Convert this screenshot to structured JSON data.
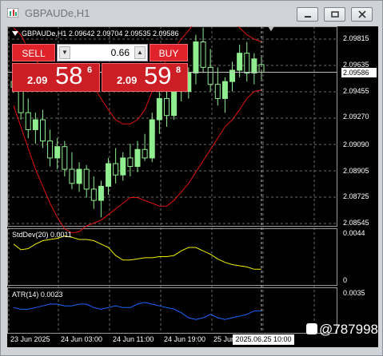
{
  "window": {
    "title": "GBPAUDe,H1",
    "minimize_icon": "minimize-icon",
    "restore_icon": "restore-icon",
    "close_icon": "close-icon"
  },
  "chart_header": {
    "symbol_line": "GBPAUDe,H1  2.09642 2.09704 2.09535 2.09586"
  },
  "trade_panel": {
    "sell_label": "SELL",
    "buy_label": "BUY",
    "lot_value": "0.66",
    "sell_quote": {
      "prefix": "2.09",
      "big": "58",
      "sup": "6"
    },
    "buy_quote": {
      "prefix": "2.09",
      "big": "59",
      "sup": "8"
    }
  },
  "price_axis": {
    "labels": [
      "2.09815",
      "2.09635",
      "2.09455",
      "2.09270",
      "2.09090",
      "2.08905",
      "2.08725",
      "2.08545"
    ],
    "current_price": "2.09586"
  },
  "stddev_panel": {
    "label": "StdDev(20) 0.0011",
    "axis_labels": [
      "0.0044",
      "0"
    ]
  },
  "atr_panel": {
    "label": "ATR(14) 0.0023",
    "axis_labels": [
      "0.0035"
    ]
  },
  "time_axis": {
    "labels": [
      "23 Jun 2025",
      "24 Jun 03:00",
      "24 Jun 11:00",
      "24 Jun 19:00",
      "25 Jun"
    ],
    "crosshair_time": "2025.06.25 10:00"
  },
  "colors": {
    "bull_candle": "#90ee90",
    "bear_candle": "#000000",
    "bollinger": "#e01010",
    "stddev_line": "#f0f000",
    "atr_line": "#1e64ff",
    "sell_buy_red": "#e0232b"
  },
  "watermark": {
    "text": "@787998"
  },
  "chart_data": {
    "type": "candlestick",
    "title": "GBPAUDe,H1",
    "ohlc_last": {
      "open": 2.09642,
      "high": 2.09704,
      "low": 2.09535,
      "close": 2.09586
    },
    "ylim": [
      2.085,
      2.0991
    ],
    "candles": [
      {
        "o": 2.0952,
        "h": 2.0962,
        "l": 2.0944,
        "c": 2.0948
      },
      {
        "o": 2.0948,
        "h": 2.0956,
        "l": 2.0925,
        "c": 2.093
      },
      {
        "o": 2.093,
        "h": 2.094,
        "l": 2.0912,
        "c": 2.0918
      },
      {
        "o": 2.0918,
        "h": 2.093,
        "l": 2.0908,
        "c": 2.0925
      },
      {
        "o": 2.0925,
        "h": 2.0932,
        "l": 2.0905,
        "c": 2.091
      },
      {
        "o": 2.091,
        "h": 2.0918,
        "l": 2.0892,
        "c": 2.0898
      },
      {
        "o": 2.0898,
        "h": 2.0912,
        "l": 2.089,
        "c": 2.0906
      },
      {
        "o": 2.0906,
        "h": 2.091,
        "l": 2.0885,
        "c": 2.089
      },
      {
        "o": 2.089,
        "h": 2.0902,
        "l": 2.0876,
        "c": 2.088
      },
      {
        "o": 2.088,
        "h": 2.0895,
        "l": 2.0874,
        "c": 2.089
      },
      {
        "o": 2.089,
        "h": 2.0893,
        "l": 2.087,
        "c": 2.0876
      },
      {
        "o": 2.0876,
        "h": 2.0885,
        "l": 2.0862,
        "c": 2.0868
      },
      {
        "o": 2.0868,
        "h": 2.0882,
        "l": 2.0856,
        "c": 2.0878
      },
      {
        "o": 2.0878,
        "h": 2.0898,
        "l": 2.0872,
        "c": 2.0894
      },
      {
        "o": 2.0894,
        "h": 2.0905,
        "l": 2.088,
        "c": 2.0886
      },
      {
        "o": 2.0886,
        "h": 2.0902,
        "l": 2.0882,
        "c": 2.0898
      },
      {
        "o": 2.0898,
        "h": 2.0908,
        "l": 2.0885,
        "c": 2.0892
      },
      {
        "o": 2.0892,
        "h": 2.091,
        "l": 2.0888,
        "c": 2.0904
      },
      {
        "o": 2.0904,
        "h": 2.0915,
        "l": 2.0896,
        "c": 2.0898
      },
      {
        "o": 2.0898,
        "h": 2.093,
        "l": 2.0895,
        "c": 2.0925
      },
      {
        "o": 2.0925,
        "h": 2.0948,
        "l": 2.0915,
        "c": 2.094
      },
      {
        "o": 2.094,
        "h": 2.0952,
        "l": 2.092,
        "c": 2.0928
      },
      {
        "o": 2.0928,
        "h": 2.0955,
        "l": 2.0925,
        "c": 2.095
      },
      {
        "o": 2.095,
        "h": 2.0958,
        "l": 2.0938,
        "c": 2.0945
      },
      {
        "o": 2.0945,
        "h": 2.0962,
        "l": 2.094,
        "c": 2.0958
      },
      {
        "o": 2.0958,
        "h": 2.0985,
        "l": 2.095,
        "c": 2.098
      },
      {
        "o": 2.098,
        "h": 2.099,
        "l": 2.0958,
        "c": 2.0962
      },
      {
        "o": 2.0962,
        "h": 2.0975,
        "l": 2.0945,
        "c": 2.095
      },
      {
        "o": 2.095,
        "h": 2.0962,
        "l": 2.0935,
        "c": 2.094
      },
      {
        "o": 2.094,
        "h": 2.0955,
        "l": 2.093,
        "c": 2.0952
      },
      {
        "o": 2.0952,
        "h": 2.0966,
        "l": 2.0945,
        "c": 2.096
      },
      {
        "o": 2.096,
        "h": 2.0978,
        "l": 2.0955,
        "c": 2.0972
      },
      {
        "o": 2.0972,
        "h": 2.098,
        "l": 2.0952,
        "c": 2.0958
      },
      {
        "o": 2.0958,
        "h": 2.0972,
        "l": 2.095,
        "c": 2.0968
      },
      {
        "o": 2.0964,
        "h": 2.097,
        "l": 2.09535,
        "c": 2.09586
      }
    ],
    "bollinger_upper": [
      2.099,
      2.0985,
      2.0975,
      2.0968,
      2.096,
      2.0955,
      2.0955,
      2.0952,
      2.095,
      2.0948,
      2.095,
      2.0948,
      2.094,
      2.0932,
      2.0925,
      2.0922,
      2.0922,
      2.0925,
      2.0932,
      2.0945,
      2.0958,
      2.0968,
      2.0975,
      2.0982,
      2.0988,
      2.0995,
      2.1002,
      2.1005,
      2.1002,
      2.0998,
      2.0995,
      2.099,
      2.0985,
      2.0982,
      2.098
    ],
    "bollinger_lower": [
      2.0935,
      2.092,
      2.0905,
      2.089,
      2.0878,
      2.0866,
      2.0856,
      2.0848,
      2.0845,
      2.0846,
      2.085,
      2.0852,
      2.0854,
      2.0858,
      2.0862,
      2.0866,
      2.087,
      2.087,
      2.0868,
      2.0866,
      2.0864,
      2.0864,
      2.0868,
      2.0874,
      2.088,
      2.0888,
      2.0896,
      2.0904,
      2.0912,
      2.092,
      2.0925,
      2.0932,
      2.094,
      2.0945,
      2.0946
    ],
    "stddev": [
      0.0033,
      0.0028,
      0.0029,
      0.0033,
      0.0036,
      0.0037,
      0.0038,
      0.004,
      0.0039,
      0.0037,
      0.0037,
      0.0036,
      0.0033,
      0.003,
      0.0023,
      0.0019,
      0.0019,
      0.002,
      0.0021,
      0.0021,
      0.0022,
      0.0022,
      0.0023,
      0.0027,
      0.003,
      0.003,
      0.0027,
      0.0024,
      0.002,
      0.0017,
      0.0015,
      0.0014,
      0.0013,
      0.0011,
      0.0011
    ],
    "stddev_ylim": [
      0,
      0.0044
    ],
    "atr": [
      0.0025,
      0.0024,
      0.0024,
      0.0025,
      0.0026,
      0.0027,
      0.0027,
      0.0026,
      0.0026,
      0.0027,
      0.0027,
      0.0025,
      0.0024,
      0.0025,
      0.0026,
      0.0025,
      0.0025,
      0.0027,
      0.0028,
      0.0027,
      0.0026,
      0.0025,
      0.0024,
      0.0022,
      0.0019,
      0.0018,
      0.0019,
      0.0021,
      0.0019,
      0.0018,
      0.0019,
      0.002,
      0.0021,
      0.0023,
      0.0023
    ],
    "atr_ylim": [
      0.0012,
      0.0035
    ]
  }
}
